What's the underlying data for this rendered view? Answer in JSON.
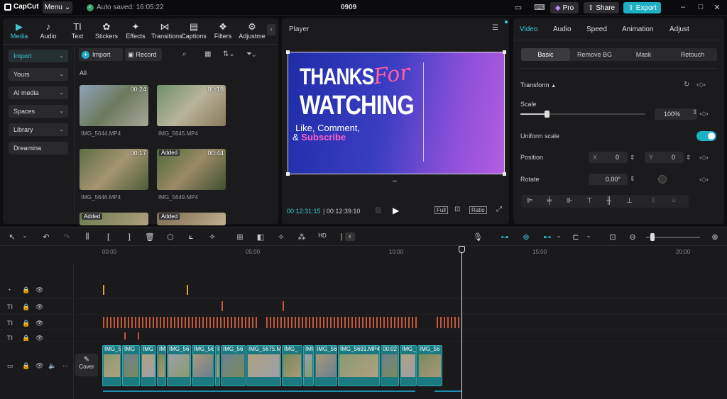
{
  "app": {
    "logo": "CapCut",
    "menu": "Menu",
    "autosave": "Auto saved: 16:05:22",
    "project": "0909",
    "pro": "Pro",
    "share": "Share",
    "export": "Export"
  },
  "media_tabs": [
    {
      "label": "Media",
      "glyph": "▶"
    },
    {
      "label": "Audio",
      "glyph": "♪"
    },
    {
      "label": "Text",
      "glyph": "TI"
    },
    {
      "label": "Stickers",
      "glyph": "✿"
    },
    {
      "label": "Effects",
      "glyph": "✦"
    },
    {
      "label": "Transitions",
      "glyph": "⋈"
    },
    {
      "label": "Captions",
      "glyph": "▤"
    },
    {
      "label": "Filters",
      "glyph": "❖"
    },
    {
      "label": "Adjustme",
      "glyph": "⚙"
    }
  ],
  "sidebar": [
    "Import",
    "Yours",
    "AI media",
    "Spaces",
    "Library",
    "Dreamina"
  ],
  "media_toolbar": {
    "import": "Import",
    "record": "Record"
  },
  "media_section": "All",
  "clips": [
    {
      "name": "IMG_5644.MP4",
      "dur": "00:24",
      "badge": ""
    },
    {
      "name": "IMG_5645.MP4",
      "dur": "00:18",
      "badge": ""
    },
    {
      "name": "IMG_5646.MP4",
      "dur": "00:17",
      "badge": ""
    },
    {
      "name": "IMG_5649.MP4",
      "dur": "00:44",
      "badge": "Added"
    },
    {
      "name": "",
      "dur": "",
      "badge": "Added"
    },
    {
      "name": "",
      "dur": "",
      "badge": "Added"
    }
  ],
  "player": {
    "title": "Player",
    "current": "00:12:31:15",
    "total": "00:12:39:10",
    "full": "Full",
    "ratio": "Ratio",
    "overlay": {
      "line1": "THANKS",
      "script": "For",
      "line2": "WATCHING",
      "line3": "Like, Comment,",
      "amp": "& ",
      "sub": "Subscribe"
    }
  },
  "props": {
    "tabs": [
      "Video",
      "Audio",
      "Speed",
      "Animation",
      "Adjust"
    ],
    "subtabs": [
      "Basic",
      "Remove BG",
      "Mask",
      "Retouch"
    ],
    "transform": "Transform",
    "scale": "Scale",
    "scale_value": "100%",
    "scale_level": 1.0,
    "uniform_scale": "Uniform scale",
    "position": "Position",
    "pos_x_label": "X",
    "pos_x": "0",
    "pos_y_label": "Y",
    "pos_y": "0",
    "rotate": "Rotate",
    "rotate_value": "0.00°"
  },
  "timeline": {
    "ticks": [
      "00:00",
      "05:00",
      "10:00",
      "15:00",
      "20:00"
    ],
    "cover": "Cover",
    "video_clips": [
      "IMG_5€",
      "IMG",
      "IMG",
      "IM",
      "IMG_56",
      "IMG_5€",
      "IM",
      "IMG_56",
      "IMG_5675.M",
      "IMG_",
      "IMG",
      "IMG_569",
      "IMG_5691.MP4",
      "00:02",
      "IMG_",
      "IMG_56"
    ]
  },
  "colors": {
    "accent": "#3fc8d8",
    "export": "#1db0c4",
    "clip": "#1b7a80",
    "text_mark": "#c4583b",
    "audio_mark": "#e0a030"
  }
}
